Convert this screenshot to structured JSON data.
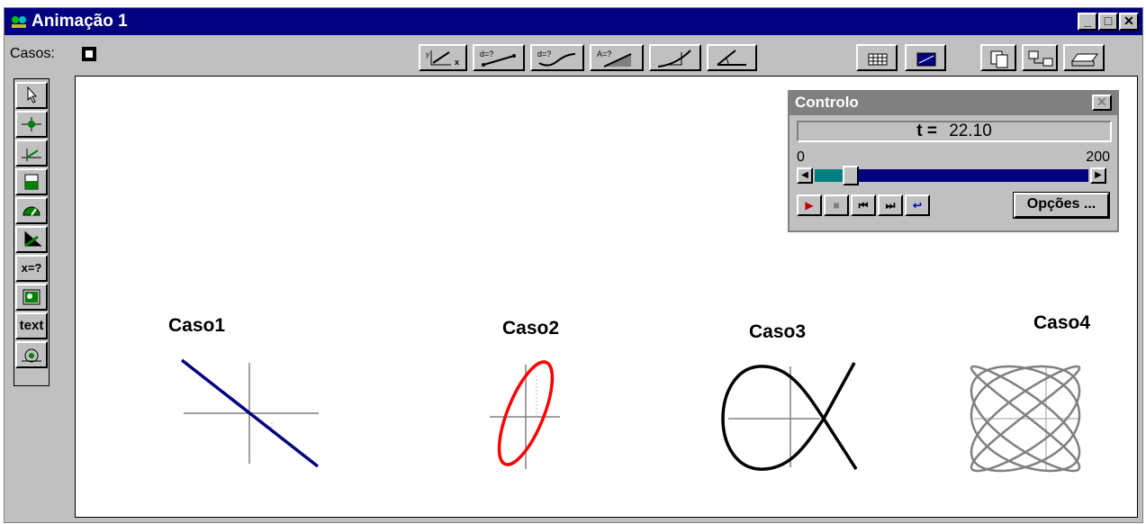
{
  "window": {
    "title": "Animação 1",
    "minimize_label": "_",
    "maximize_label": "□",
    "close_label": "✕"
  },
  "toolbar": {
    "casos_label": "Casos:",
    "math_icons": [
      "x-vs-y-graph-icon",
      "distance-time-icon",
      "distance-curve-icon",
      "area-icon",
      "tangent-slope-icon",
      "angle-icon"
    ],
    "right_icons": [
      "table-icon",
      "graph-window-icon",
      "copy-icon",
      "export-icon",
      "print-icon"
    ]
  },
  "sidebar": {
    "tools": [
      {
        "name": "arrow-select-tool",
        "label": ""
      },
      {
        "name": "particle-tool",
        "label": ""
      },
      {
        "name": "vector-tool",
        "label": ""
      },
      {
        "name": "bar-tool",
        "label": ""
      },
      {
        "name": "gauge-tool",
        "label": ""
      },
      {
        "name": "plot-tool",
        "label": ""
      },
      {
        "name": "x-equals-tool",
        "label": "x=?"
      },
      {
        "name": "image-tool",
        "label": ""
      },
      {
        "name": "text-tool",
        "label": "text"
      },
      {
        "name": "measure-tool",
        "label": ""
      }
    ]
  },
  "canvas": {
    "casos": [
      {
        "label": "Caso1",
        "color": "#000080"
      },
      {
        "label": "Caso2",
        "color": "#ff0000"
      },
      {
        "label": "Caso3",
        "color": "#000000"
      },
      {
        "label": "Caso4",
        "color": "#808080"
      }
    ]
  },
  "controlo": {
    "title": "Controlo",
    "close_label": "✕",
    "t_label": "t =",
    "t_value": "22.10",
    "min_label": "0",
    "max_label": "200",
    "slider_fraction": 0.11,
    "opcoes_label": "Opções ..."
  },
  "colors": {
    "titlebar": "#000080",
    "face": "#c0c0c0",
    "slider_track": "#000080",
    "slider_fill": "#008080"
  }
}
